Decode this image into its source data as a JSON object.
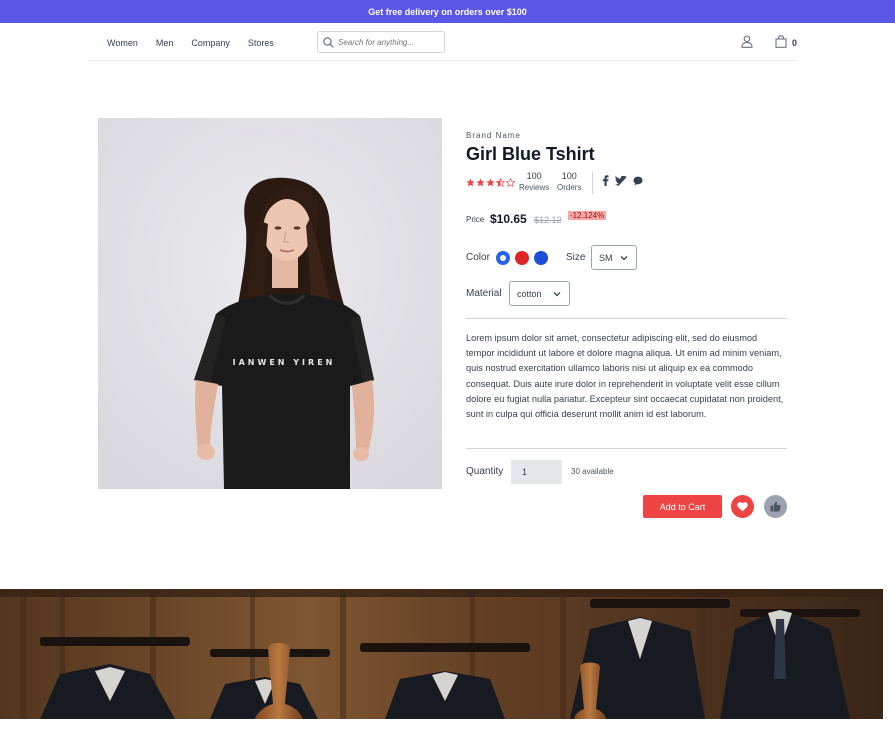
{
  "banner": {
    "text": "Get free delivery on orders over $100"
  },
  "nav": {
    "links": [
      "Women",
      "Men",
      "Company",
      "Stores"
    ],
    "search_placeholder": "Search for anything...",
    "cart_count": "0"
  },
  "product": {
    "brand": "Brand Name",
    "title": "Girl Blue Tshirt",
    "rating": 3.5,
    "rating_max": 5,
    "reviews_count": "100",
    "reviews_label": "Reviews",
    "orders_count": "100",
    "orders_label": "Orders",
    "price_label": "Price",
    "price": "$10.65",
    "old_price": "$12.12",
    "discount": "-12.124%",
    "color_label": "Color",
    "colors": [
      "#2563eb",
      "#dc2626",
      "#1d4ed8"
    ],
    "selected_color_index": 0,
    "size_label": "Size",
    "size_value": "SM",
    "material_label": "Material",
    "material_value": "cotton",
    "description": "Lorem ipsum dolor sit amet, consectetur adipiscing elit, sed do eiusmod tempor incididunt ut labore et dolore magna aliqua. Ut enim ad minim veniam, quis nostrud exercitation ullamco laboris nisi ut aliquip ex ea commodo consequat. Duis aute irure dolor in reprehenderit in voluptate velit esse cillum dolore eu fugiat nulla pariatur. Excepteur sint occaecat cupidatat non proident, sunt in culpa qui officia deserunt mollit anim id est laborum.",
    "quantity_label": "Quantity",
    "quantity_value": "1",
    "available": "30 available",
    "add_to_cart": "Add to Cart",
    "shirt_print": "IANWEN YIREN"
  },
  "icons": {
    "search": "search-icon",
    "user": "user-icon",
    "bag": "shopping-bag-icon",
    "facebook": "facebook-icon",
    "twitter": "twitter-icon",
    "chat": "chat-icon",
    "heart": "heart-icon",
    "thumbs_up": "thumbs-up-icon"
  },
  "colors": {
    "banner": "#5b57e6",
    "accent": "#ef4444",
    "star": "#ef4444"
  }
}
